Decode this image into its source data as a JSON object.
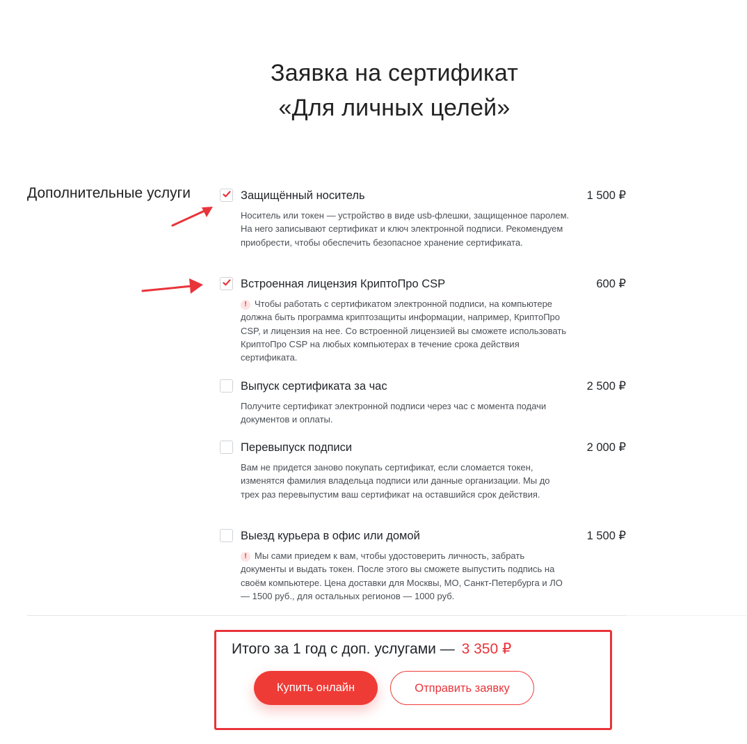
{
  "title": {
    "line1": "Заявка на сертификат",
    "line2": "«Для личных целей»"
  },
  "section_label": "Дополнительные услуги",
  "services": [
    {
      "name": "Защищённый носитель",
      "price": "1 500 ₽",
      "checked": true,
      "warning": false,
      "description": "Носитель или токен — устройство в виде usb-флешки, защищенное паролем. На него записывают сертификат и ключ электронной подписи. Рекомендуем приобрести, чтобы обеспечить безопасное хранение сертификата."
    },
    {
      "name": "Встроенная лицензия КриптоПро CSP",
      "price": "600 ₽",
      "checked": true,
      "warning": true,
      "description": "Чтобы работать с сертификатом электронной подписи, на компьютере должна быть программа криптозащиты информации, например, КриптоПро CSP, и лицензия на нее. Со встроенной лицензией вы сможете использовать КриптоПро CSP на любых компьютерах в течение срока действия сертификата."
    },
    {
      "name": "Выпуск сертификата за час",
      "price": "2 500 ₽",
      "checked": false,
      "warning": false,
      "description": "Получите сертификат электронной подписи через час с момента подачи документов и оплаты."
    },
    {
      "name": "Перевыпуск подписи",
      "price": "2 000 ₽",
      "checked": false,
      "warning": false,
      "description": "Вам не придется заново покупать сертификат, если сломается токен, изменятся фамилия владельца подписи или данные организации. Мы до трех раз перевыпустим ваш сертификат на оставшийся срок действия."
    },
    {
      "name": "Выезд курьера в офис или домой",
      "price": "1 500 ₽",
      "checked": false,
      "warning": true,
      "description": "Мы сами приедем к вам, чтобы удостоверить личность, забрать документы и выдать токен. После этого вы сможете выпустить подпись на своём компьютере. Цена доставки для Москвы, МО, Санкт-Петербурга и ЛО — 1500 руб., для остальных регионов — 1000 руб."
    }
  ],
  "total": {
    "label": "Итого за 1 год с доп. услугами  —",
    "sum": "3 350 ₽"
  },
  "buttons": {
    "buy": "Купить онлайн",
    "send": "Отправить заявку"
  },
  "colors": {
    "accent": "#ef3b36",
    "annotation": "#e8343a"
  },
  "warning_glyph": "!"
}
